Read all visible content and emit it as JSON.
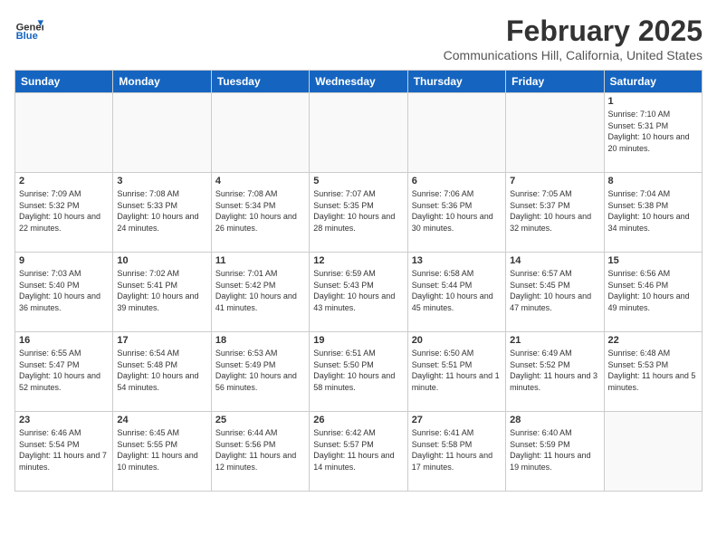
{
  "header": {
    "logo_general": "General",
    "logo_blue": "Blue",
    "title": "February 2025",
    "subtitle": "Communications Hill, California, United States"
  },
  "weekdays": [
    "Sunday",
    "Monday",
    "Tuesday",
    "Wednesday",
    "Thursday",
    "Friday",
    "Saturday"
  ],
  "weeks": [
    [
      {
        "day": "",
        "info": ""
      },
      {
        "day": "",
        "info": ""
      },
      {
        "day": "",
        "info": ""
      },
      {
        "day": "",
        "info": ""
      },
      {
        "day": "",
        "info": ""
      },
      {
        "day": "",
        "info": ""
      },
      {
        "day": "1",
        "info": "Sunrise: 7:10 AM\nSunset: 5:31 PM\nDaylight: 10 hours and 20 minutes."
      }
    ],
    [
      {
        "day": "2",
        "info": "Sunrise: 7:09 AM\nSunset: 5:32 PM\nDaylight: 10 hours and 22 minutes."
      },
      {
        "day": "3",
        "info": "Sunrise: 7:08 AM\nSunset: 5:33 PM\nDaylight: 10 hours and 24 minutes."
      },
      {
        "day": "4",
        "info": "Sunrise: 7:08 AM\nSunset: 5:34 PM\nDaylight: 10 hours and 26 minutes."
      },
      {
        "day": "5",
        "info": "Sunrise: 7:07 AM\nSunset: 5:35 PM\nDaylight: 10 hours and 28 minutes."
      },
      {
        "day": "6",
        "info": "Sunrise: 7:06 AM\nSunset: 5:36 PM\nDaylight: 10 hours and 30 minutes."
      },
      {
        "day": "7",
        "info": "Sunrise: 7:05 AM\nSunset: 5:37 PM\nDaylight: 10 hours and 32 minutes."
      },
      {
        "day": "8",
        "info": "Sunrise: 7:04 AM\nSunset: 5:38 PM\nDaylight: 10 hours and 34 minutes."
      }
    ],
    [
      {
        "day": "9",
        "info": "Sunrise: 7:03 AM\nSunset: 5:40 PM\nDaylight: 10 hours and 36 minutes."
      },
      {
        "day": "10",
        "info": "Sunrise: 7:02 AM\nSunset: 5:41 PM\nDaylight: 10 hours and 39 minutes."
      },
      {
        "day": "11",
        "info": "Sunrise: 7:01 AM\nSunset: 5:42 PM\nDaylight: 10 hours and 41 minutes."
      },
      {
        "day": "12",
        "info": "Sunrise: 6:59 AM\nSunset: 5:43 PM\nDaylight: 10 hours and 43 minutes."
      },
      {
        "day": "13",
        "info": "Sunrise: 6:58 AM\nSunset: 5:44 PM\nDaylight: 10 hours and 45 minutes."
      },
      {
        "day": "14",
        "info": "Sunrise: 6:57 AM\nSunset: 5:45 PM\nDaylight: 10 hours and 47 minutes."
      },
      {
        "day": "15",
        "info": "Sunrise: 6:56 AM\nSunset: 5:46 PM\nDaylight: 10 hours and 49 minutes."
      }
    ],
    [
      {
        "day": "16",
        "info": "Sunrise: 6:55 AM\nSunset: 5:47 PM\nDaylight: 10 hours and 52 minutes."
      },
      {
        "day": "17",
        "info": "Sunrise: 6:54 AM\nSunset: 5:48 PM\nDaylight: 10 hours and 54 minutes."
      },
      {
        "day": "18",
        "info": "Sunrise: 6:53 AM\nSunset: 5:49 PM\nDaylight: 10 hours and 56 minutes."
      },
      {
        "day": "19",
        "info": "Sunrise: 6:51 AM\nSunset: 5:50 PM\nDaylight: 10 hours and 58 minutes."
      },
      {
        "day": "20",
        "info": "Sunrise: 6:50 AM\nSunset: 5:51 PM\nDaylight: 11 hours and 1 minute."
      },
      {
        "day": "21",
        "info": "Sunrise: 6:49 AM\nSunset: 5:52 PM\nDaylight: 11 hours and 3 minutes."
      },
      {
        "day": "22",
        "info": "Sunrise: 6:48 AM\nSunset: 5:53 PM\nDaylight: 11 hours and 5 minutes."
      }
    ],
    [
      {
        "day": "23",
        "info": "Sunrise: 6:46 AM\nSunset: 5:54 PM\nDaylight: 11 hours and 7 minutes."
      },
      {
        "day": "24",
        "info": "Sunrise: 6:45 AM\nSunset: 5:55 PM\nDaylight: 11 hours and 10 minutes."
      },
      {
        "day": "25",
        "info": "Sunrise: 6:44 AM\nSunset: 5:56 PM\nDaylight: 11 hours and 12 minutes."
      },
      {
        "day": "26",
        "info": "Sunrise: 6:42 AM\nSunset: 5:57 PM\nDaylight: 11 hours and 14 minutes."
      },
      {
        "day": "27",
        "info": "Sunrise: 6:41 AM\nSunset: 5:58 PM\nDaylight: 11 hours and 17 minutes."
      },
      {
        "day": "28",
        "info": "Sunrise: 6:40 AM\nSunset: 5:59 PM\nDaylight: 11 hours and 19 minutes."
      },
      {
        "day": "",
        "info": ""
      }
    ]
  ]
}
